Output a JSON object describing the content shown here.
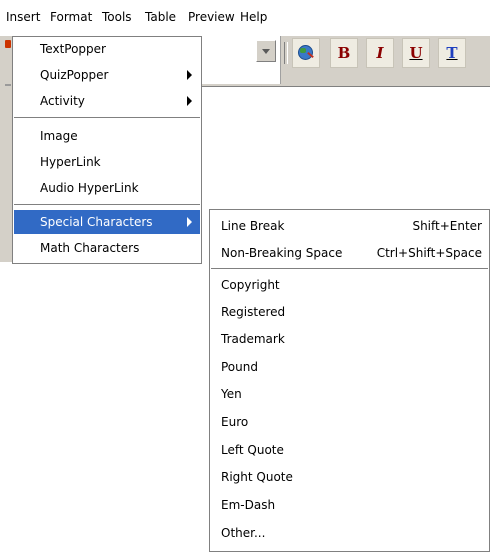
{
  "menubar": [
    "Insert",
    "Format",
    "Tools",
    "Table",
    "Preview",
    "Help"
  ],
  "toolbar": {
    "find_icon": "globe-magnifier-icon",
    "buttons": [
      "B",
      "I",
      "U",
      "T"
    ],
    "colors": {
      "bold": "#8b0000",
      "italic": "#8b0000",
      "underline": "#8b0000",
      "text_color": "#1f3fbf"
    }
  },
  "insert_menu": {
    "items": [
      {
        "label": "TextPopper"
      },
      {
        "label": "QuizPopper",
        "submenu": true
      },
      {
        "label": "Activity",
        "submenu": true
      },
      {
        "label": "Image"
      },
      {
        "label": "HyperLink"
      },
      {
        "label": "Audio HyperLink"
      },
      {
        "label": "Special Characters",
        "submenu": true,
        "highlighted": true
      },
      {
        "label": "Math Characters"
      }
    ]
  },
  "special_characters_menu": {
    "items": [
      {
        "label": "Line Break",
        "shortcut": "Shift+Enter"
      },
      {
        "label": "Non-Breaking Space",
        "shortcut": "Ctrl+Shift+Space"
      },
      {
        "label": "Copyright"
      },
      {
        "label": "Registered"
      },
      {
        "label": "Trademark"
      },
      {
        "label": "Pound"
      },
      {
        "label": "Yen"
      },
      {
        "label": "Euro"
      },
      {
        "label": "Left Quote"
      },
      {
        "label": "Right Quote"
      },
      {
        "label": "Em-Dash"
      },
      {
        "label": "Other..."
      }
    ]
  },
  "colors": {
    "highlight": "#316ac5",
    "menu_bg": "#ffffff",
    "chrome": "#d4d0c8"
  }
}
